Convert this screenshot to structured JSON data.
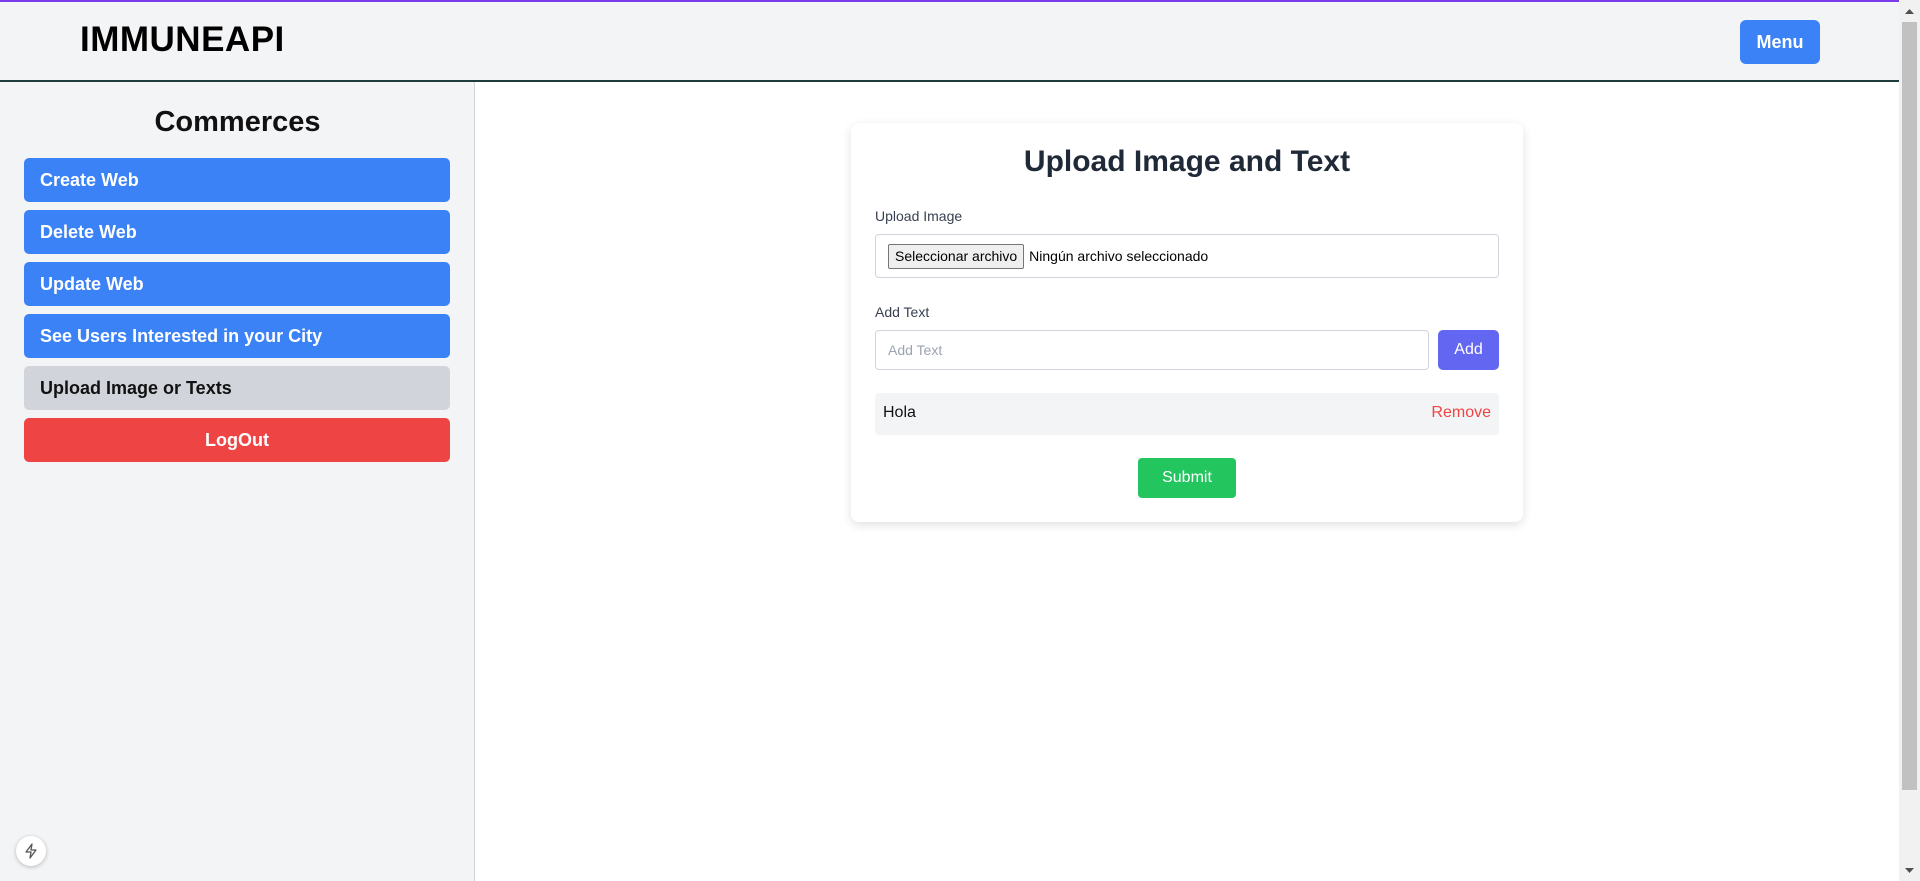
{
  "header": {
    "brand": "IMMUNEAPI",
    "menu_label": "Menu"
  },
  "sidebar": {
    "title": "Commerces",
    "items": [
      {
        "label": "Create Web"
      },
      {
        "label": "Delete Web"
      },
      {
        "label": "Update Web"
      },
      {
        "label": "See Users Interested in your City"
      },
      {
        "label": "Upload Image or Texts",
        "active": true
      },
      {
        "label": "LogOut"
      }
    ]
  },
  "form": {
    "title": "Upload Image and Text",
    "upload_label": "Upload Image",
    "file_button": "Seleccionar archivo",
    "file_status": "Ningún archivo seleccionado",
    "text_label": "Add Text",
    "text_placeholder": "Add Text",
    "text_value": "",
    "add_label": "Add",
    "texts": [
      {
        "text": "Hola",
        "remove_label": "Remove"
      }
    ],
    "submit_label": "Submit"
  },
  "colors": {
    "primary": "#3b82f6",
    "danger": "#ef4444",
    "success": "#22c55e",
    "indigo": "#6366f1",
    "sidebar_bg": "#f3f4f6",
    "active_item": "#d1d5db"
  },
  "icons": {
    "bolt": "bolt-icon",
    "scroll_up": "chevron-up-icon",
    "scroll_down": "chevron-down-icon"
  }
}
